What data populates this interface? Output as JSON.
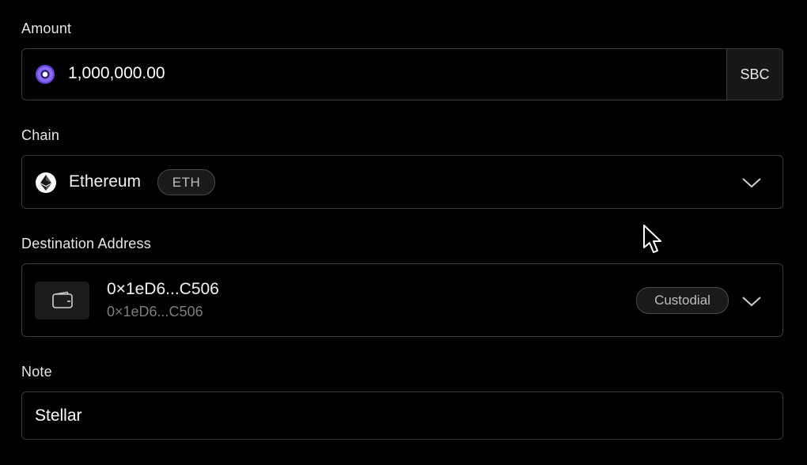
{
  "amount": {
    "label": "Amount",
    "value": "1,000,000.00",
    "currency": "SBC",
    "token_icon": "sbc-token-icon"
  },
  "chain": {
    "label": "Chain",
    "selected_name": "Ethereum",
    "selected_symbol": "ETH",
    "icon": "ethereum-icon"
  },
  "destination": {
    "label": "Destination Address",
    "address_primary": "0×1eD6...C506",
    "address_secondary": "0×1eD6...C506",
    "badge": "Custodial",
    "icon": "wallet-icon"
  },
  "note": {
    "label": "Note",
    "value": "Stellar"
  },
  "colors": {
    "background": "#000000",
    "border": "#3a3a3a",
    "muted_text": "#7c7c7c",
    "token_accent": "#8b6cf0"
  }
}
